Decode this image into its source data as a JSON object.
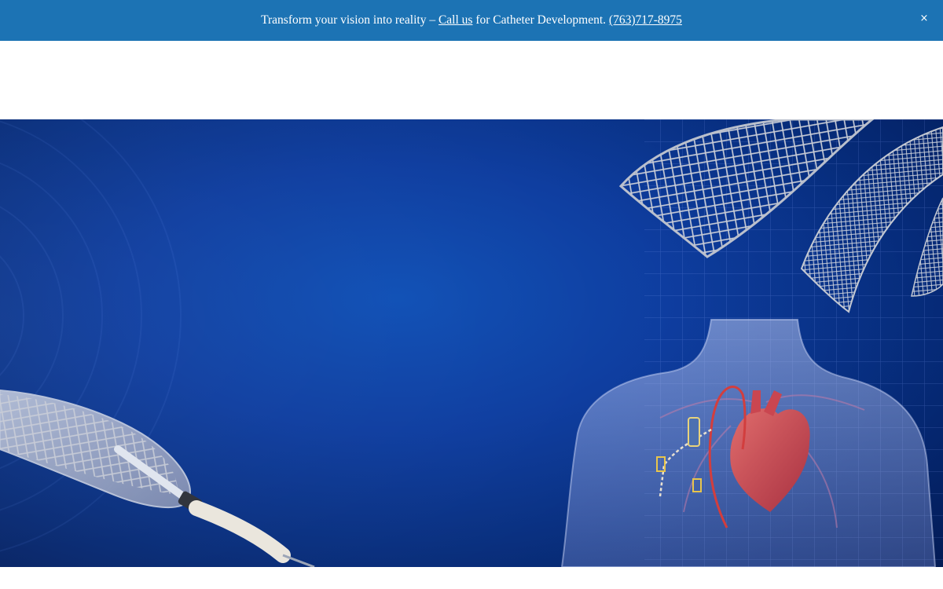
{
  "announcement": {
    "prefix": "Transform your vision into reality – ",
    "call_link": "Call us",
    "middle": " for Catheter Development. ",
    "phone_link": "(763)717-8975",
    "close_label": "×",
    "background_color": "#1c73b4"
  },
  "hero": {
    "background_color": "#0a3a9e",
    "icons": [
      "stent-balloon-catheter-illustration",
      "stent-mesh-illustration",
      "torso-heart-catheter-illustration"
    ]
  }
}
